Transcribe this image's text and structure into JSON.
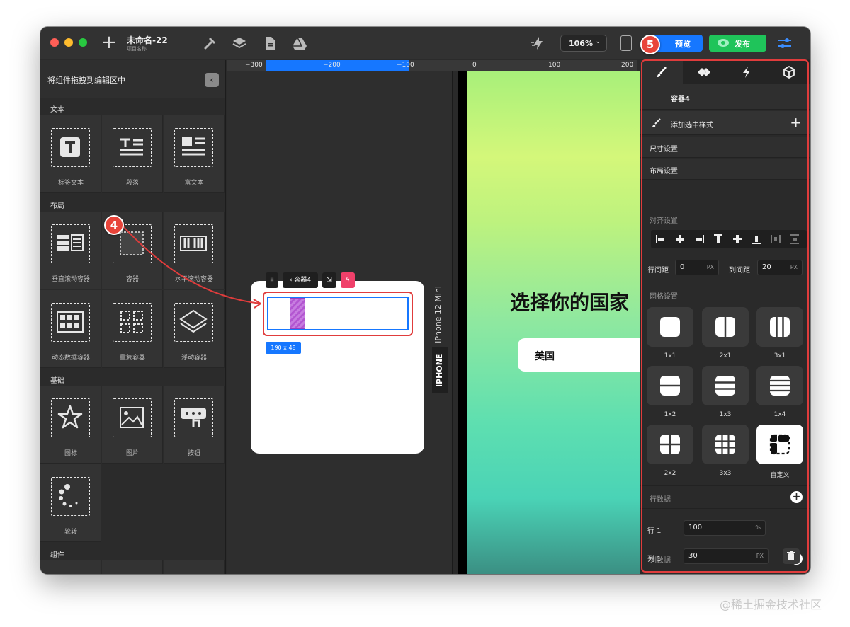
{
  "titlebar": {
    "project_name": "未命名-22",
    "project_sub": "项目名称",
    "zoom": "106%",
    "preview_label": "预览",
    "publish_label": "发布"
  },
  "left_panel": {
    "title": "将组件拖拽到编辑区中",
    "sections": {
      "text": "文本",
      "layout": "布局",
      "basic": "基础",
      "components": "组件"
    },
    "text_items": [
      "标签文本",
      "段落",
      "富文本"
    ],
    "layout_items": [
      "垂直滚动容器",
      "容器",
      "水平滚动容器",
      "动态数据容器",
      "重复容器",
      "浮动容器"
    ],
    "basic_items": [
      "图标",
      "图片",
      "按钮",
      "轮转"
    ]
  },
  "ruler": {
    "labels": [
      "−300",
      "−200",
      "−100",
      "0",
      "100",
      "200"
    ]
  },
  "canvas": {
    "toolbar_label": "容器4",
    "size_tag": "190 x 48",
    "device_name": "iPhone 12 Mini",
    "device_tab": "IPHONE",
    "preview_title": "选择你的国家",
    "country": "美国"
  },
  "badges": {
    "step4": "4",
    "step5": "5"
  },
  "right_panel": {
    "element_name": "容器4",
    "add_style": "添加选中样式",
    "size_settings": "尺寸设置",
    "layout_settings": "布局设置",
    "align_settings": "对齐设置",
    "row_gap_label": "行间距",
    "row_gap_value": "0",
    "row_gap_unit": "PX",
    "col_gap_label": "列间距",
    "col_gap_value": "20",
    "col_gap_unit": "PX",
    "grid_settings": "网格设置",
    "grid_options": [
      "1x1",
      "2x1",
      "3x1",
      "1x2",
      "1x3",
      "1x4",
      "2x2",
      "3x3",
      "自定义"
    ],
    "selected_grid": "自定义",
    "row_data": "行数据",
    "row1_label": "行 1",
    "row1_value": "100",
    "row1_unit": "%",
    "col_data": "列数据",
    "col1_label": "列 1",
    "col1_value": "30",
    "col1_unit": "PX"
  },
  "watermark": "@稀土掘金技术社区",
  "colors": {
    "accent_blue": "#1677ff",
    "publish_green": "#1fc45a",
    "annotation_red": "#e03c3c"
  }
}
